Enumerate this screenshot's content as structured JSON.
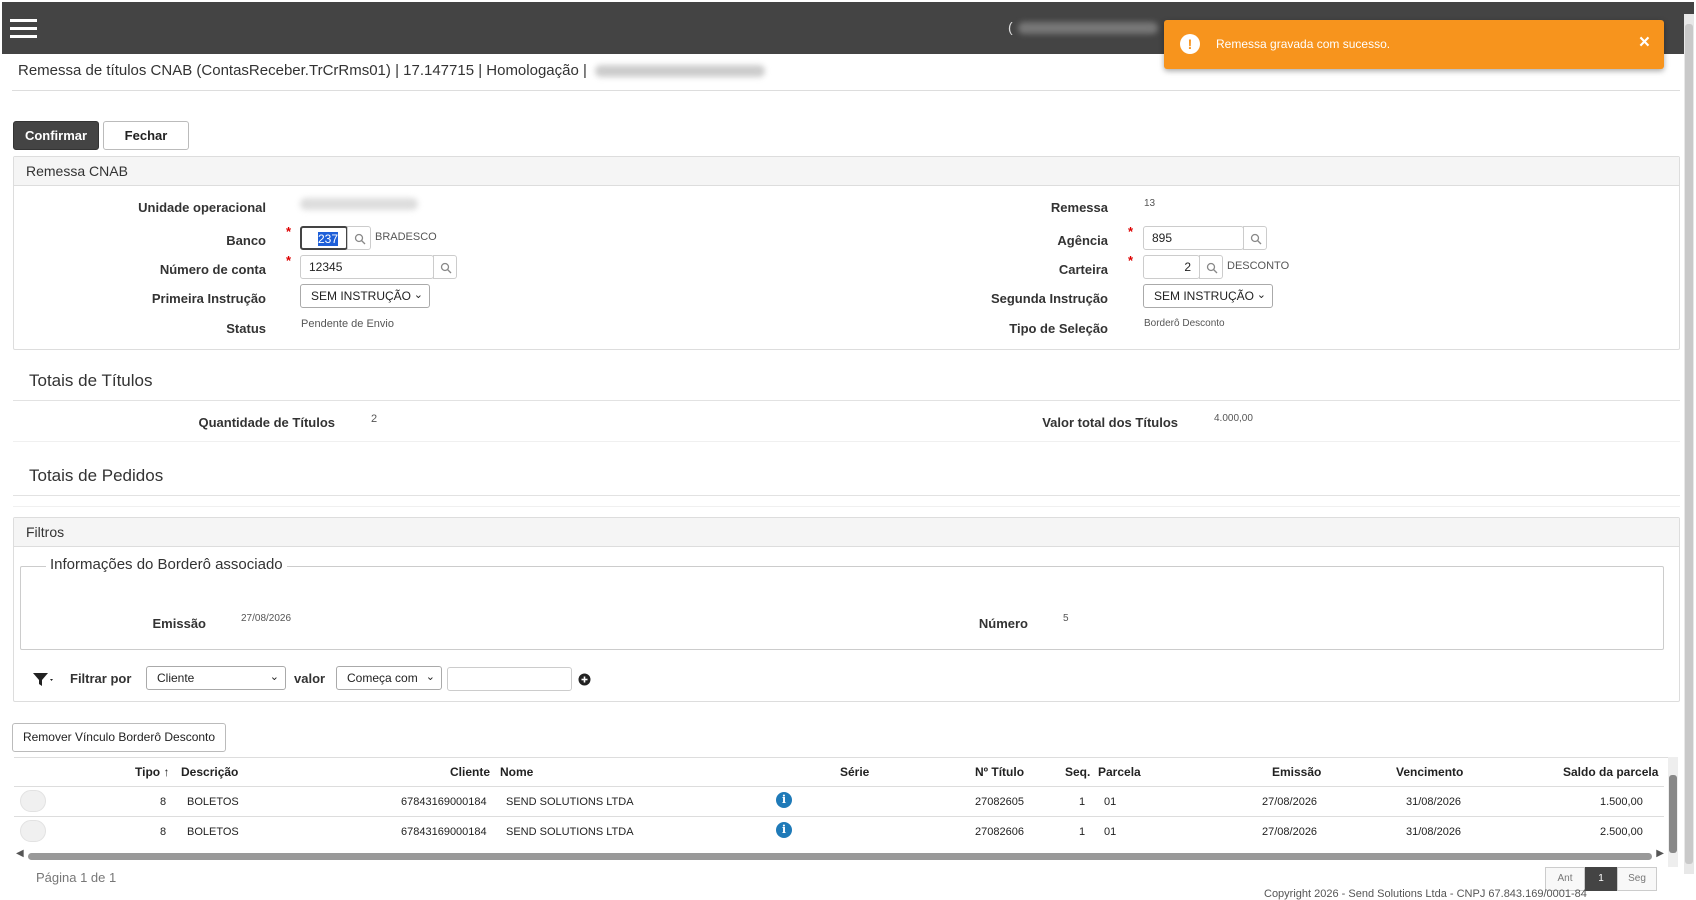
{
  "header": {
    "user_paren": "(",
    "subtitle": "Remessa de títulos CNAB (ContasReceber.TrCrRms01) | 17.147715 | Homologação |"
  },
  "toast": {
    "message": "Remessa gravada com sucesso.",
    "close": "×",
    "icon": "!"
  },
  "toolbar": {
    "confirm": "Confirmar",
    "close": "Fechar"
  },
  "remessa": {
    "title": "Remessa CNAB",
    "unidade_label": "Unidade operacional",
    "banco_label": "Banco",
    "banco_value": "237",
    "banco_name": "BRADESCO",
    "conta_label": "Número de conta",
    "conta_value": "12345",
    "primeira_label": "Primeira Instrução",
    "primeira_value": "SEM INSTRUÇÃO",
    "status_label": "Status",
    "status_value": "Pendente de Envio",
    "remessa_label": "Remessa",
    "remessa_value": "13",
    "agencia_label": "Agência",
    "agencia_value": "895",
    "carteira_label": "Carteira",
    "carteira_value": "2",
    "carteira_name": "DESCONTO",
    "segunda_label": "Segunda Instrução",
    "segunda_value": "SEM INSTRUÇÃO",
    "tipo_label": "Tipo de Seleção",
    "tipo_value": "Borderô Desconto"
  },
  "totais_titulos": {
    "title": "Totais de Títulos",
    "qtd_label": "Quantidade de Títulos",
    "qtd_value": "2",
    "valor_label": "Valor total dos Títulos",
    "valor_value": "4.000,00"
  },
  "totais_pedidos": {
    "title": "Totais de Pedidos"
  },
  "filtros": {
    "title": "Filtros",
    "bordero_legend": "Informações do Borderô associado",
    "emissao_label": "Emissão",
    "emissao_value": "27/08/2026",
    "numero_label": "Número",
    "numero_value": "5",
    "filtrar_label": "Filtrar por",
    "filtrar_value": "Cliente",
    "valor_label": "valor",
    "cond_value": "Começa com",
    "text_value": ""
  },
  "actions": {
    "remove_link": "Remover Vínculo Borderô Desconto"
  },
  "grid": {
    "headers": {
      "tipo": "Tipo",
      "sort": "↑",
      "descricao": "Descrição",
      "cliente": "Cliente",
      "nome": "Nome",
      "serie": "Série",
      "titulo": "Nº Título",
      "seq": "Seq.",
      "parcela": "Parcela",
      "emissao": "Emissão",
      "vencimento": "Vencimento",
      "saldo": "Saldo da parcela"
    },
    "rows": [
      {
        "tipo": "8",
        "descricao": "BOLETOS",
        "cliente": "67843169000184",
        "nome": "SEND SOLUTIONS LTDA",
        "titulo": "27082605",
        "seq": "1",
        "parcela": "01",
        "emissao": "27/08/2026",
        "vencimento": "31/08/2026",
        "saldo": "1.500,00"
      },
      {
        "tipo": "8",
        "descricao": "BOLETOS",
        "cliente": "67843169000184",
        "nome": "SEND SOLUTIONS LTDA",
        "titulo": "27082606",
        "seq": "1",
        "parcela": "01",
        "emissao": "27/08/2026",
        "vencimento": "31/08/2026",
        "saldo": "2.500,00"
      }
    ],
    "info_icon": "i"
  },
  "pager": {
    "text": "Página 1 de 1",
    "prev": "Ant",
    "page": "1",
    "next": "Seg"
  },
  "footer": {
    "text": "Copyright 2026 - Send Solutions Ltda - CNPJ 67.843.169/0001-84"
  }
}
